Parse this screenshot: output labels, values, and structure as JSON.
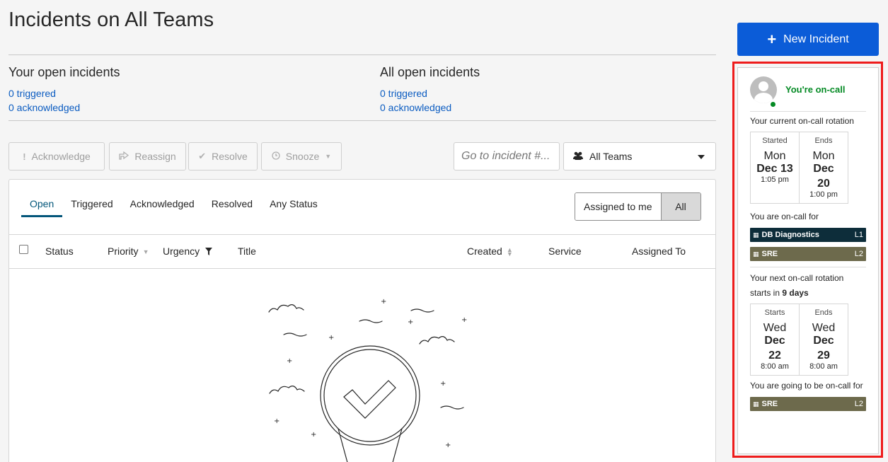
{
  "page": {
    "title": "Incidents on All Teams"
  },
  "summary": {
    "yours": {
      "heading": "Your open incidents",
      "triggered": "0 triggered",
      "acknowledged": "0 acknowledged"
    },
    "all": {
      "heading": "All open incidents",
      "triggered": "0 triggered",
      "acknowledged": "0 acknowledged"
    }
  },
  "toolbar": {
    "acknowledge": "Acknowledge",
    "reassign": "Reassign",
    "resolve": "Resolve",
    "snooze": "Snooze",
    "goto_placeholder": "Go to incident #...",
    "teams": "All Teams"
  },
  "tabs": [
    "Open",
    "Triggered",
    "Acknowledged",
    "Resolved",
    "Any Status"
  ],
  "assignment": {
    "assigned_to_me": "Assigned to me",
    "all": "All"
  },
  "columns": {
    "status": "Status",
    "priority": "Priority",
    "urgency": "Urgency",
    "title": "Title",
    "created": "Created",
    "service": "Service",
    "assigned_to": "Assigned To"
  },
  "new_incident": "New Incident",
  "oncall": {
    "status": "You're on-call",
    "current_label": "Your current on-call rotation",
    "current": {
      "start_label": "Started",
      "start_day": "Mon",
      "start_date": "Dec 13",
      "start_time": "1:05 pm",
      "end_label": "Ends",
      "end_day": "Mon",
      "end_month": "Dec",
      "end_date": "20",
      "end_time": "1:00 pm"
    },
    "for_label": "You are on-call for",
    "current_services": [
      {
        "name": "DB Diagnostics",
        "level": "L1"
      },
      {
        "name": "SRE",
        "level": "L2"
      }
    ],
    "next_label_pre": "Your next on-call rotation starts in",
    "next_in": "9 days",
    "next": {
      "start_label": "Starts",
      "start_day": "Wed",
      "start_month": "Dec",
      "start_date": "22",
      "start_time": "8:00 am",
      "end_label": "Ends",
      "end_day": "Wed",
      "end_month": "Dec",
      "end_date": "29",
      "end_time": "8:00 am"
    },
    "going_label": "You are going to be on-call for",
    "next_services": [
      {
        "name": "SRE",
        "level": "L2"
      }
    ]
  },
  "colors": {
    "primary": "#0b5cd8",
    "oncall_green": "#048a24",
    "link": "#0b5cc1",
    "badge_navy": "#0d2d3a",
    "badge_olive": "#6d6a4c",
    "highlight": "#ee1c1c"
  }
}
